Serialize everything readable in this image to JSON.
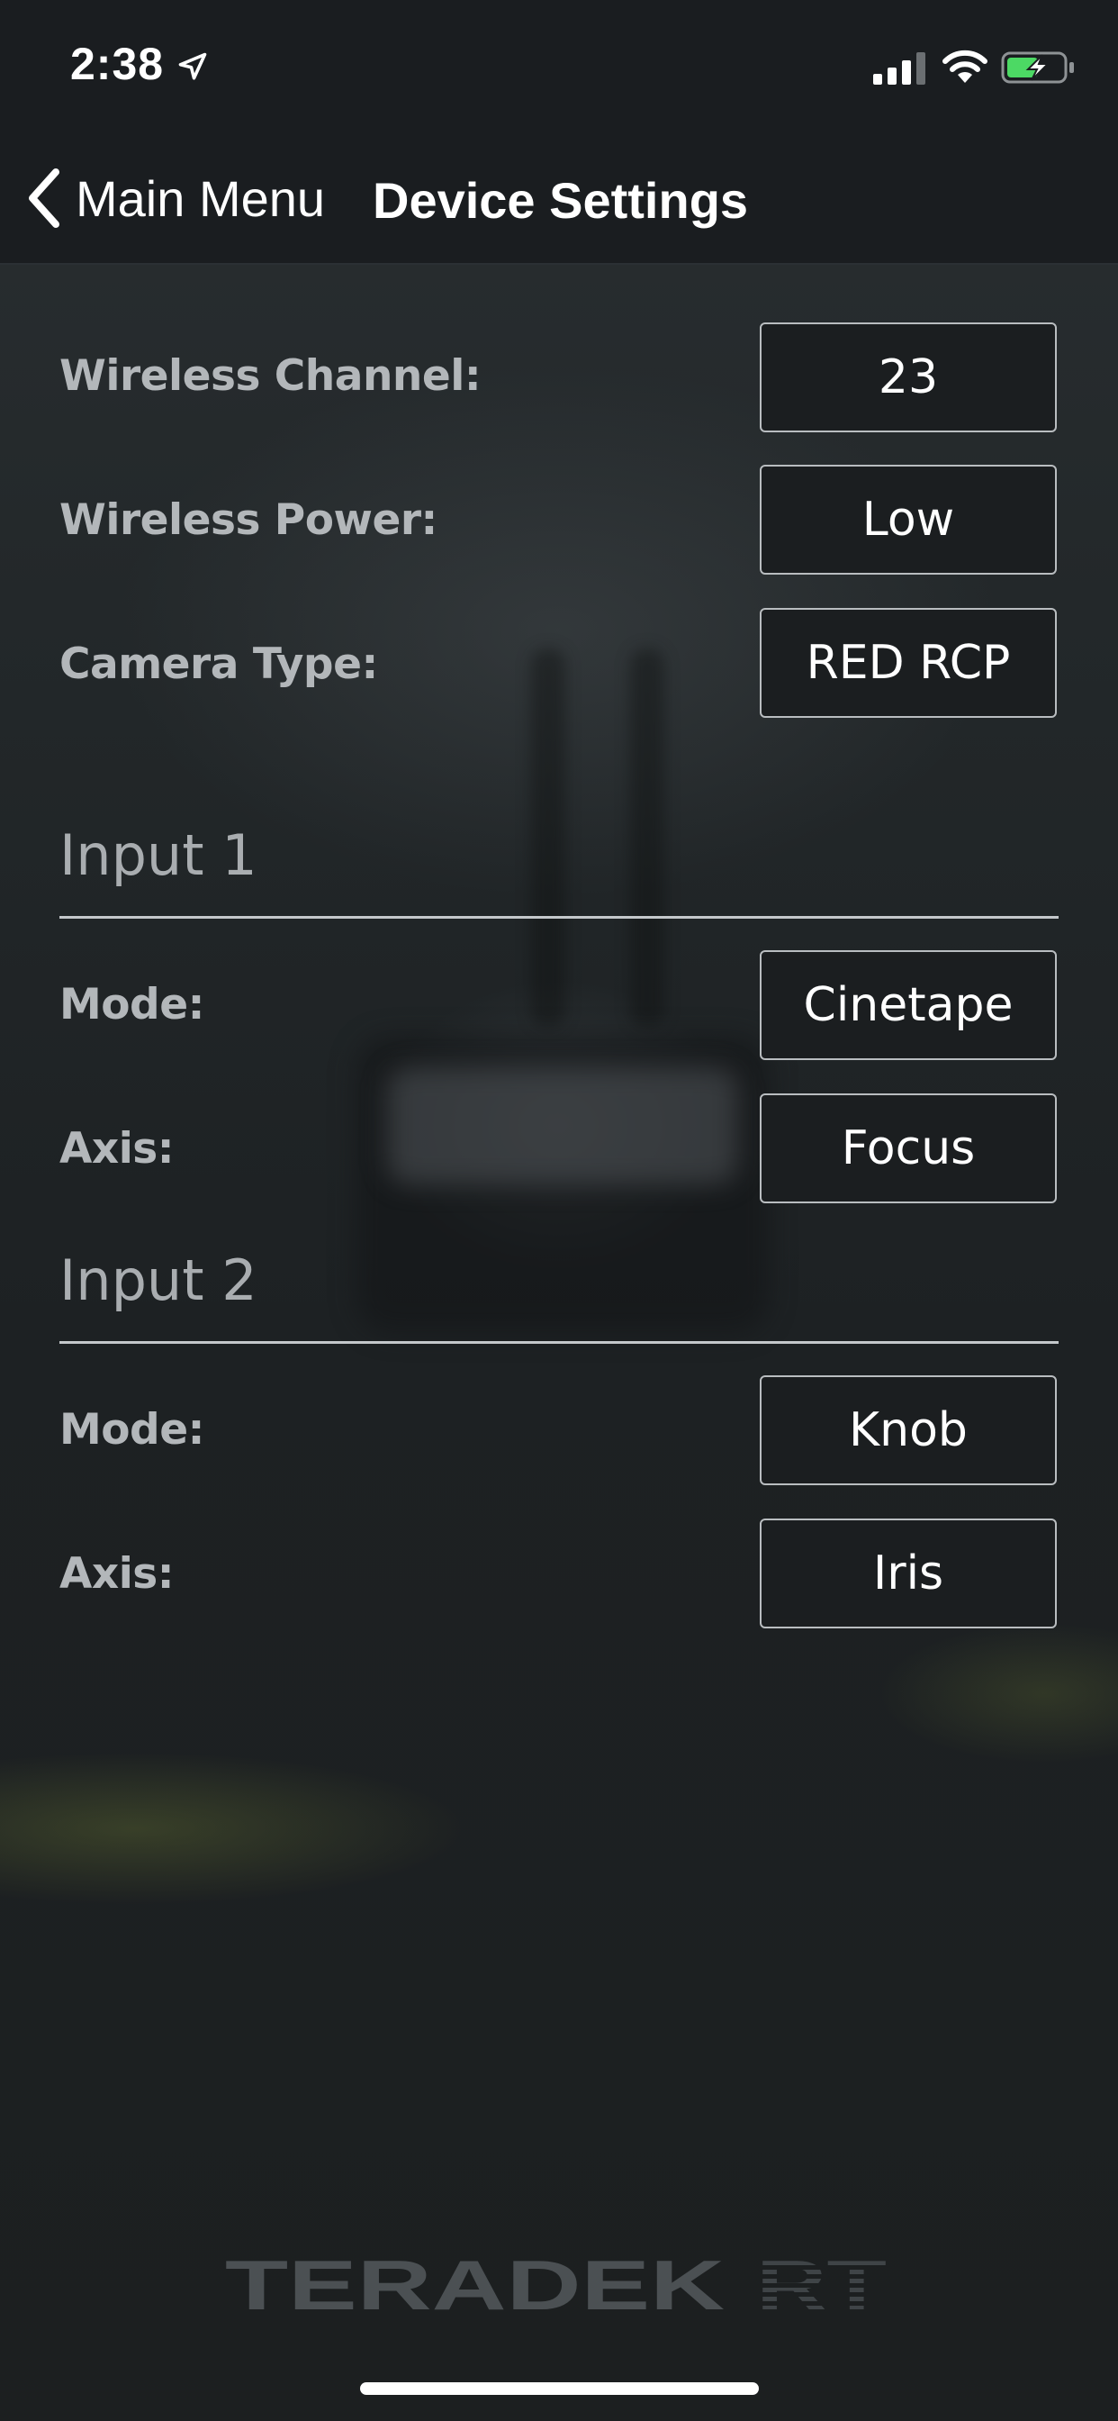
{
  "status_bar": {
    "time": "2:38",
    "location_icon": "location-arrow-icon",
    "signal_icon": "cellular-signal-icon",
    "wifi_icon": "wifi-icon",
    "battery_icon": "battery-charging-icon",
    "battery_color": "#4cd964"
  },
  "nav": {
    "back_label": "Main Menu",
    "back_icon": "chevron-left-icon",
    "title": "Device Settings"
  },
  "settings": {
    "wireless_channel": {
      "label": "Wireless Channel:",
      "value": "23"
    },
    "wireless_power": {
      "label": "Wireless Power:",
      "value": "Low"
    },
    "camera_type": {
      "label": "Camera Type:",
      "value": "RED RCP"
    }
  },
  "inputs": [
    {
      "header": "Input 1",
      "mode": {
        "label": "Mode:",
        "value": "Cinetape"
      },
      "axis": {
        "label": "Axis:",
        "value": "Focus"
      }
    },
    {
      "header": "Input 2",
      "mode": {
        "label": "Mode:",
        "value": "Knob"
      },
      "axis": {
        "label": "Axis:",
        "value": "Iris"
      }
    }
  ],
  "footer": {
    "logo_text_main": "TERADEK",
    "logo_text_sub": "RT"
  },
  "colors": {
    "background": "#1c2022",
    "bar_background": "#1a1d20",
    "label_gray": "#b3b7ba",
    "box_border": "#b9bdc0"
  }
}
